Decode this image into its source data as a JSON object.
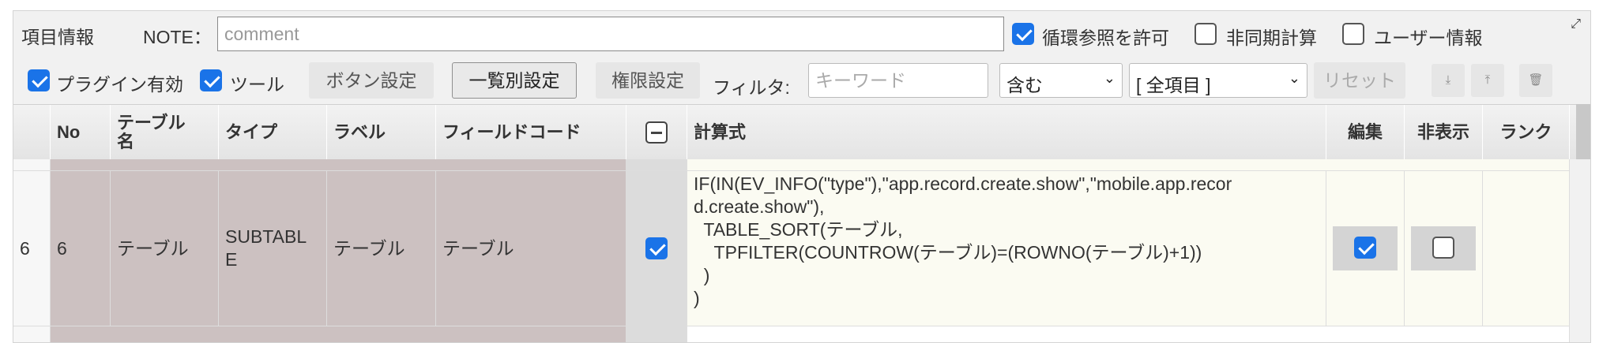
{
  "header": {
    "title": "項目情報",
    "note_label": "NOTE：",
    "note_placeholder": "comment",
    "options": [
      {
        "label": "循環参照を許可",
        "checked": true
      },
      {
        "label": "非同期計算",
        "checked": false
      },
      {
        "label": "ユーザー情報",
        "checked": false
      }
    ]
  },
  "toolbar": {
    "plugin_enabled": {
      "label": "プラグイン有効",
      "checked": true
    },
    "tool": {
      "label": "ツール",
      "checked": true
    },
    "button_settings": "ボタン設定",
    "list_settings": "一覧別設定",
    "permission_settings": "権限設定",
    "filter_label": "フィルタ:",
    "keyword_placeholder": "キーワード",
    "match_select": "含む",
    "field_select": "[ 全項目 ]",
    "reset": "リセット",
    "icon_download": "⤓",
    "icon_upload": "⤒",
    "icon_delete": "🗑"
  },
  "table": {
    "headers": {
      "no": "No",
      "table_name": "テーブル\n名",
      "type": "タイプ",
      "label": "ラベル",
      "field_code": "フィールドコード",
      "formula": "計算式",
      "edit": "編集",
      "hidden": "非表示",
      "rank": "ランク"
    },
    "rows": [
      {
        "index": "6",
        "no": "6",
        "table_name": "テーブル",
        "type": "SUBTABL\nE",
        "label": "テーブル",
        "field_code": "テーブル",
        "selected": true,
        "formula": "IF(IN(EV_INFO(\"type\"),\"app.record.create.show\",\"mobile.app.recor\nd.create.show\"),\n  TABLE_SORT(テーブル,\n    TPFILTER(COUNTROW(テーブル)=(ROWNO(テーブル)+1))\n  )\n)",
        "edit": true,
        "hidden": false,
        "rank": ""
      }
    ]
  },
  "colors": {
    "accent": "#1a73e8",
    "row_brown": "#ccc1c1",
    "formula_bg": "#fbfbf2"
  }
}
